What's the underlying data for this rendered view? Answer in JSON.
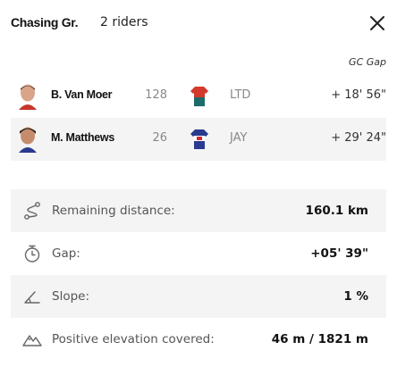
{
  "header": {
    "group_title": "Chasing Gr.",
    "rider_count": "2 riders"
  },
  "column_header": {
    "gc_gap": "GC Gap"
  },
  "riders": [
    {
      "name": "B. Van Moer",
      "rank": "128",
      "team": "LTD",
      "gap": "+ 18' 56\"",
      "jersey_colors": [
        "#d23a2c",
        "#1d6b6b"
      ]
    },
    {
      "name": "M. Matthews",
      "rank": "26",
      "team": "JAY",
      "gap": "+ 29' 24\"",
      "jersey_colors": [
        "#2a3a8f",
        "#d8262e"
      ]
    }
  ],
  "stats": [
    {
      "label": "Remaining distance:",
      "value": "160.1 km",
      "icon": "route-icon"
    },
    {
      "label": "Gap:",
      "value": "+05' 39\"",
      "icon": "stopwatch-icon"
    },
    {
      "label": "Slope:",
      "value": "1 %",
      "icon": "slope-icon"
    },
    {
      "label": "Positive elevation covered:",
      "value": "46 m / 1821 m",
      "icon": "mountain-icon"
    }
  ]
}
